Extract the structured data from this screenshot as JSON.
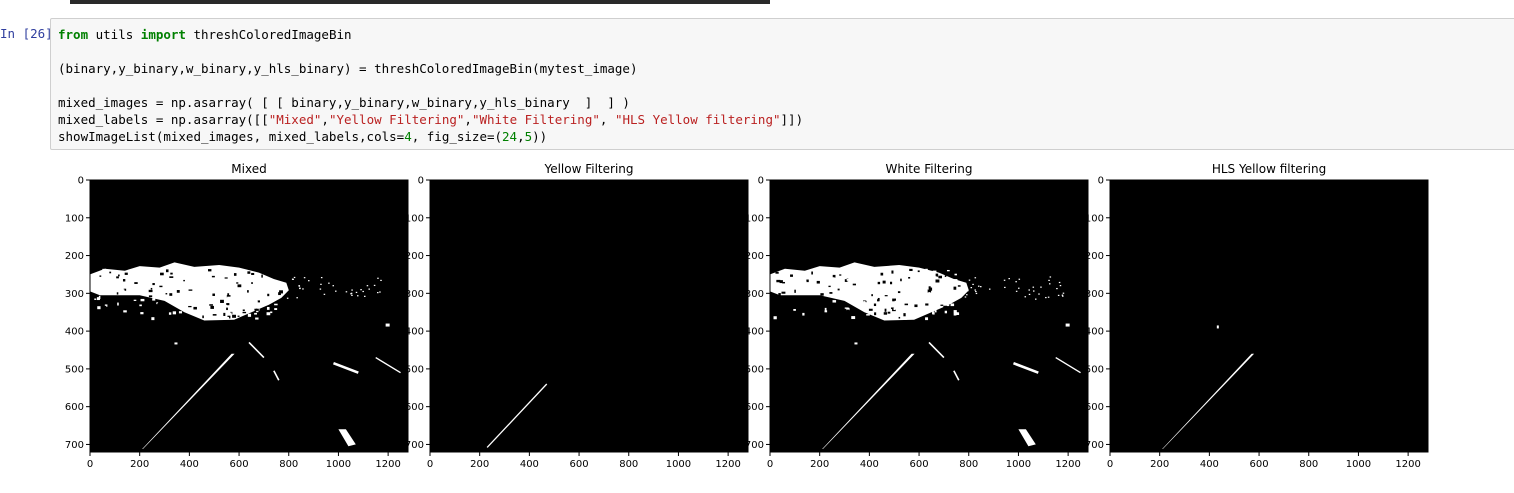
{
  "cell": {
    "prompt": "In [26]:",
    "lines": [
      [
        {
          "t": "from",
          "c": "kw"
        },
        {
          "t": " utils ",
          "c": ""
        },
        {
          "t": "import",
          "c": "kw"
        },
        {
          "t": " threshColoredImageBin",
          "c": ""
        }
      ],
      [],
      [
        {
          "t": "(binary,y_binary,w_binary,y_hls_binary) = threshColoredImageBin(mytest_image)",
          "c": ""
        }
      ],
      [],
      [
        {
          "t": "mixed_images = np.asarray( [ [ binary,y_binary,w_binary,y_hls_binary  ]  ] )",
          "c": ""
        }
      ],
      [
        {
          "t": "mixed_labels = np.asarray([[",
          "c": ""
        },
        {
          "t": "\"Mixed\"",
          "c": "str"
        },
        {
          "t": ",",
          "c": ""
        },
        {
          "t": "\"Yellow Filtering\"",
          "c": "str"
        },
        {
          "t": ",",
          "c": ""
        },
        {
          "t": "\"White Filtering\"",
          "c": "str"
        },
        {
          "t": ", ",
          "c": ""
        },
        {
          "t": "\"HLS Yellow filtering\"",
          "c": "str"
        },
        {
          "t": "]])",
          "c": ""
        }
      ],
      [
        {
          "t": "showImageList(mixed_images, mixed_labels,cols=",
          "c": ""
        },
        {
          "t": "4",
          "c": "num"
        },
        {
          "t": ", fig_size=(",
          "c": ""
        },
        {
          "t": "24",
          "c": "num"
        },
        {
          "t": ",",
          "c": ""
        },
        {
          "t": "5",
          "c": "num"
        },
        {
          "t": "))",
          "c": ""
        }
      ]
    ]
  },
  "output": {
    "panels": [
      {
        "title": "Mixed"
      },
      {
        "title": "Yellow Filtering"
      },
      {
        "title": "White Filtering"
      },
      {
        "title": "HLS Yellow filtering"
      }
    ],
    "x_ticks": [
      "0",
      "200",
      "400",
      "600",
      "800",
      "1000",
      "1200"
    ],
    "y_ticks": [
      "0",
      "100",
      "200",
      "300",
      "400",
      "500",
      "600",
      "700"
    ],
    "image_size": {
      "width": 1280,
      "height": 720
    },
    "colors": {
      "background": "#000000",
      "foreground": "#ffffff",
      "cell_bg": "#f7f7f7",
      "prompt": "#303f9f"
    }
  }
}
